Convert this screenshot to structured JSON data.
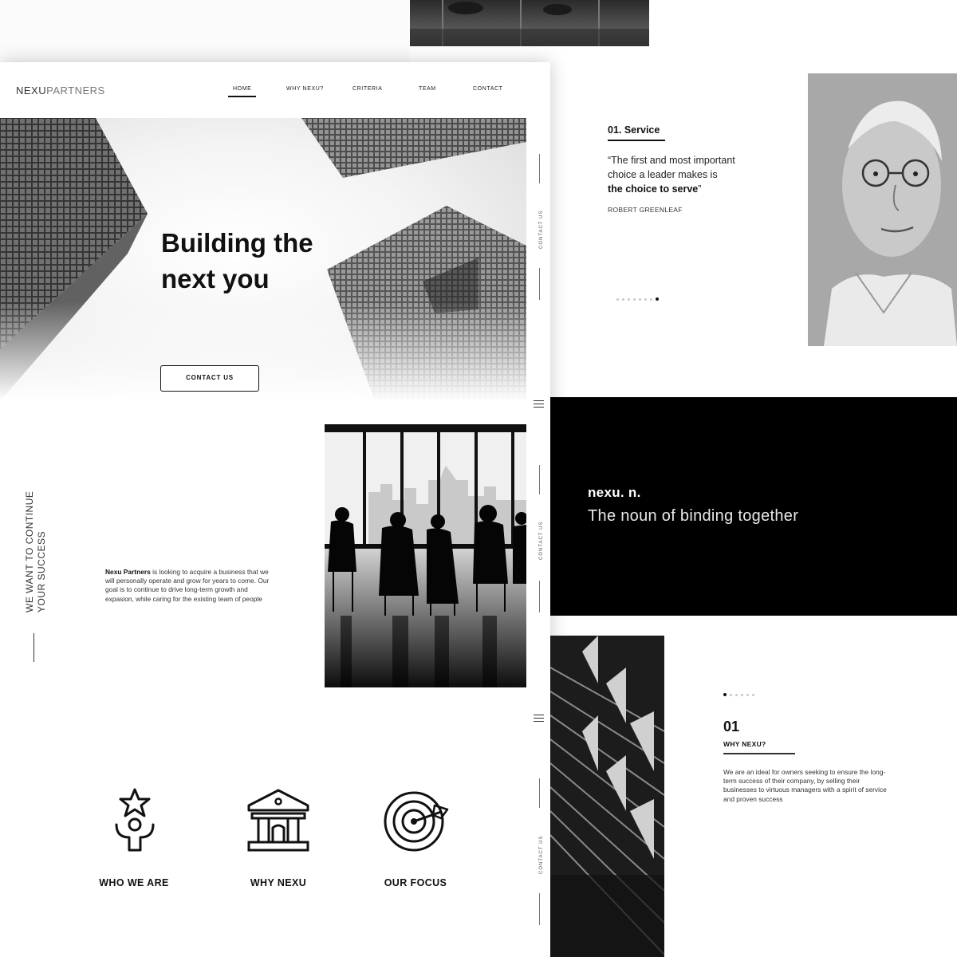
{
  "header": {
    "logo_bold": "NEXU",
    "logo_thin": "PARTNERS",
    "nav": [
      {
        "label": "HOME",
        "active": true
      },
      {
        "label": "WHY NEXU?",
        "active": false
      },
      {
        "label": "CRITERIA",
        "active": false
      },
      {
        "label": "TEAM",
        "active": false
      },
      {
        "label": "CONTACT",
        "active": false
      }
    ]
  },
  "hero": {
    "title_line1": "Building the",
    "title_line2": "next you",
    "button_label": "CONTACT US"
  },
  "side_rail": {
    "label": "CONTACT US",
    "menu_icon": "hamburger-icon"
  },
  "about": {
    "slogan_line1": "WE WANT TO CONTINUE",
    "slogan_line2": "YOUR SUCCESS",
    "company": "Nexu Partners",
    "text": " is looking to acquire a business that we will personally operate and grow for years to come. Our goal is to continue  to drive long-term growth and expasion, while caring for the existing team of people"
  },
  "features": [
    {
      "label": "WHO WE ARE",
      "icon": "person-star-icon"
    },
    {
      "label": "WHY NEXU",
      "icon": "bank-building-icon"
    },
    {
      "label": "OUR FOCUS",
      "icon": "target-icon"
    }
  ],
  "quote": {
    "heading": "01. Service",
    "text_line1": "“The first and most important",
    "text_line2": "choice a leader makes is",
    "text_bold": "the choice to serve",
    "text_end": "”",
    "author": "ROBERT GREENLEAF",
    "slides_total": 8,
    "slide_active": 8
  },
  "definition": {
    "word": "nexu. n.",
    "meaning": "The noun of binding together"
  },
  "why": {
    "slides_total": 6,
    "slide_active": 1,
    "number": "01",
    "title": "WHY NEXU?",
    "text": "We are an ideal for owners seeking to ensure the long-term success of their company, by selling their businesses to virtuous managers with a spirit of service and proven success"
  },
  "colors": {
    "ink": "#111111",
    "band": "#000000",
    "background": "#ffffff"
  }
}
